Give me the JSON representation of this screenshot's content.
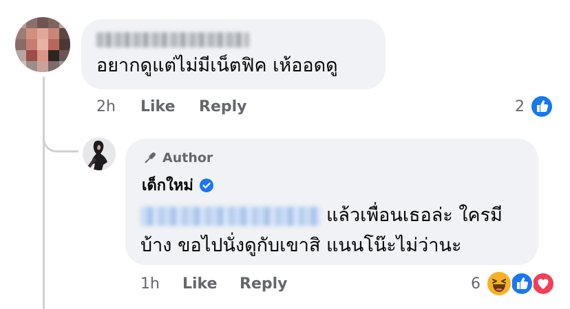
{
  "comment": {
    "author_name": "",
    "text": "อยากดูแต่ไม่มีเน็ตฟิค เห้ออดดู",
    "time": "2h",
    "like_label": "Like",
    "reply_label": "Reply",
    "reaction_count": "2",
    "reactions": [
      "like-icon"
    ]
  },
  "reply": {
    "badge_label": "Author",
    "author_name": "เด็กใหม่",
    "verified": true,
    "mention": "",
    "text_line1": "แล้วเพื่อนเธอล่ะ ใครมี",
    "text_line2": "บ้าง ขอไปนั่งดูกับเขาสิ แนนโน๊ะไม่ว่านะ",
    "time": "1h",
    "like_label": "Like",
    "reply_label": "Reply",
    "reaction_count": "6",
    "reactions": [
      "haha-icon",
      "like-icon",
      "love-icon"
    ]
  },
  "colors": {
    "bubble": "#f0f2f5",
    "meta_text": "#65676b",
    "like_blue": "#1877f2",
    "love_red": "#f33e58",
    "haha_yellow": "#f7b125"
  }
}
